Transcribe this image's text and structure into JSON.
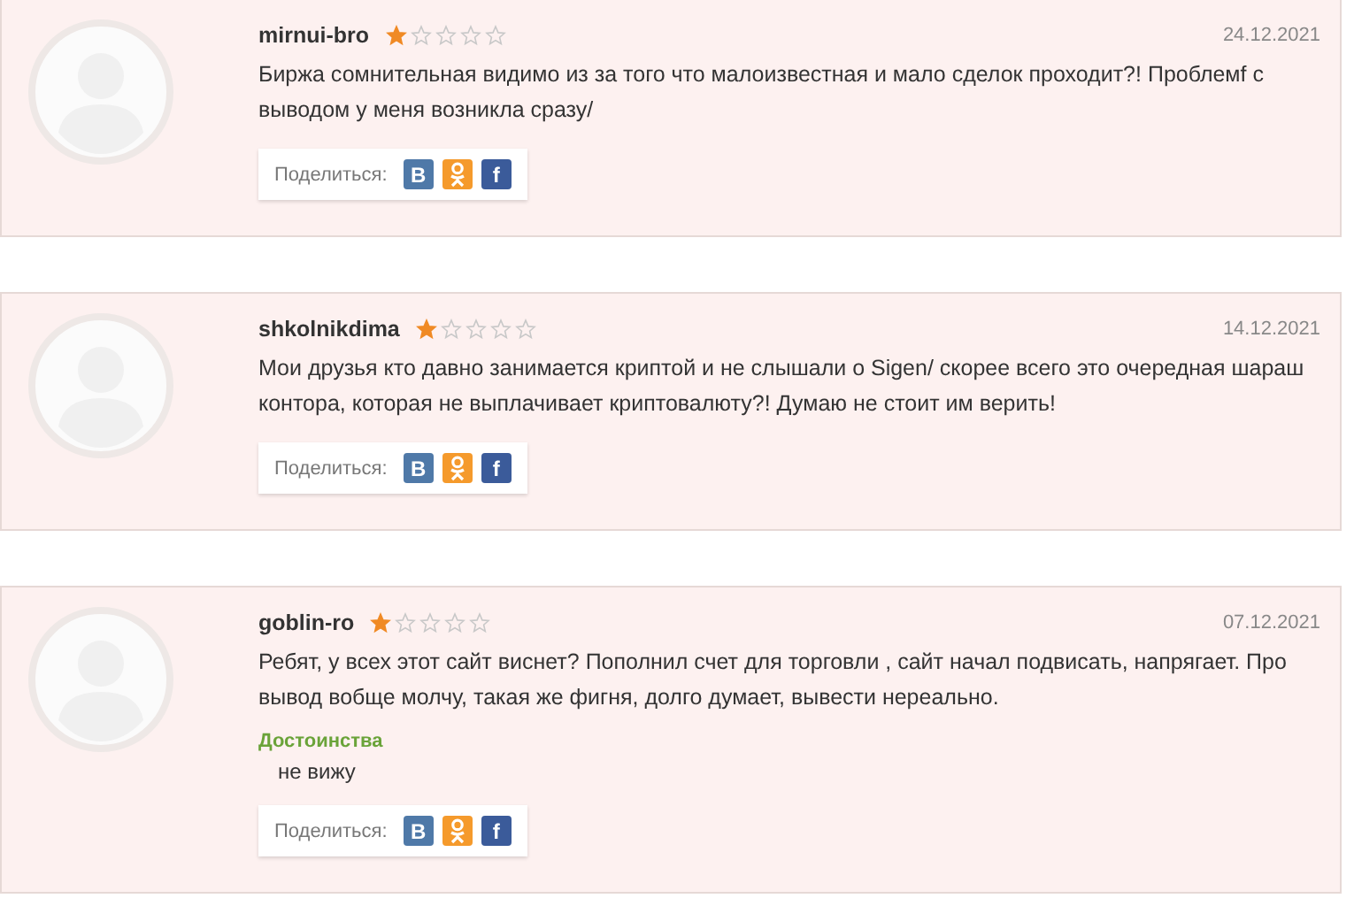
{
  "reviews": [
    {
      "author": "mirnui-bro",
      "stars": 1,
      "date": "24.12.2021",
      "text": "Биржа сомнительная видимо из за того что малоизвестная и мало сделок проходит?! Проблемf c выводом у меня возникла сразу/",
      "share": {
        "label": "Поделиться:",
        "buttons": [
          {
            "kind": "vk",
            "label": "B"
          },
          {
            "kind": "ok"
          },
          {
            "kind": "fb",
            "label": "f"
          }
        ]
      }
    },
    {
      "author": "shkolnikdima",
      "stars": 1,
      "date": "14.12.2021",
      "text": "Мои друзья кто давно занимается криптой и не слышали о Sigen/ скорее всего это очередная шараш контора, которая не выплачивает криптовалюту?! Думаю не стоит им верить!",
      "share": {
        "label": "Поделиться:",
        "buttons": [
          {
            "kind": "vk",
            "label": "B"
          },
          {
            "kind": "ok"
          },
          {
            "kind": "fb",
            "label": "f"
          }
        ]
      }
    },
    {
      "author": "goblin-ro",
      "stars": 1,
      "date": "07.12.2021",
      "text": "Ребят, у всех этот сайт виснет? Пополнил счет для торговли , сайт начал подвисать, напрягает. Про вывод вобще молчу, такая же фигня, долго думает, вывести нереально.",
      "pros": {
        "title": "Достоинства",
        "text": "не вижу"
      },
      "share": {
        "label": "Поделиться:",
        "buttons": [
          {
            "kind": "vk",
            "label": "B"
          },
          {
            "kind": "ok"
          },
          {
            "kind": "fb",
            "label": "f"
          }
        ]
      }
    }
  ]
}
